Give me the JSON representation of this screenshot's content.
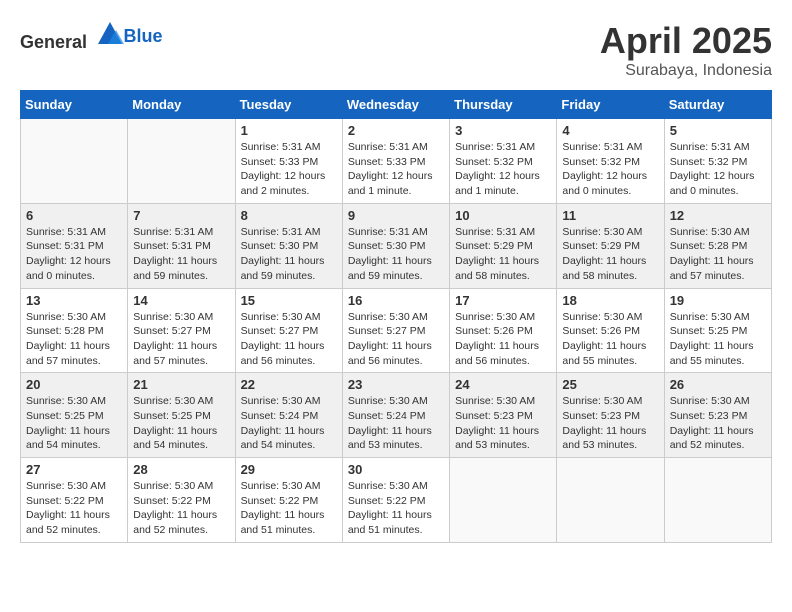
{
  "header": {
    "logo_general": "General",
    "logo_blue": "Blue",
    "month": "April 2025",
    "location": "Surabaya, Indonesia"
  },
  "days_of_week": [
    "Sunday",
    "Monday",
    "Tuesday",
    "Wednesday",
    "Thursday",
    "Friday",
    "Saturday"
  ],
  "weeks": [
    [
      {
        "day": "",
        "info": ""
      },
      {
        "day": "",
        "info": ""
      },
      {
        "day": "1",
        "info": "Sunrise: 5:31 AM\nSunset: 5:33 PM\nDaylight: 12 hours and 2 minutes."
      },
      {
        "day": "2",
        "info": "Sunrise: 5:31 AM\nSunset: 5:33 PM\nDaylight: 12 hours and 1 minute."
      },
      {
        "day": "3",
        "info": "Sunrise: 5:31 AM\nSunset: 5:32 PM\nDaylight: 12 hours and 1 minute."
      },
      {
        "day": "4",
        "info": "Sunrise: 5:31 AM\nSunset: 5:32 PM\nDaylight: 12 hours and 0 minutes."
      },
      {
        "day": "5",
        "info": "Sunrise: 5:31 AM\nSunset: 5:32 PM\nDaylight: 12 hours and 0 minutes."
      }
    ],
    [
      {
        "day": "6",
        "info": "Sunrise: 5:31 AM\nSunset: 5:31 PM\nDaylight: 12 hours and 0 minutes."
      },
      {
        "day": "7",
        "info": "Sunrise: 5:31 AM\nSunset: 5:31 PM\nDaylight: 11 hours and 59 minutes."
      },
      {
        "day": "8",
        "info": "Sunrise: 5:31 AM\nSunset: 5:30 PM\nDaylight: 11 hours and 59 minutes."
      },
      {
        "day": "9",
        "info": "Sunrise: 5:31 AM\nSunset: 5:30 PM\nDaylight: 11 hours and 59 minutes."
      },
      {
        "day": "10",
        "info": "Sunrise: 5:31 AM\nSunset: 5:29 PM\nDaylight: 11 hours and 58 minutes."
      },
      {
        "day": "11",
        "info": "Sunrise: 5:30 AM\nSunset: 5:29 PM\nDaylight: 11 hours and 58 minutes."
      },
      {
        "day": "12",
        "info": "Sunrise: 5:30 AM\nSunset: 5:28 PM\nDaylight: 11 hours and 57 minutes."
      }
    ],
    [
      {
        "day": "13",
        "info": "Sunrise: 5:30 AM\nSunset: 5:28 PM\nDaylight: 11 hours and 57 minutes."
      },
      {
        "day": "14",
        "info": "Sunrise: 5:30 AM\nSunset: 5:27 PM\nDaylight: 11 hours and 57 minutes."
      },
      {
        "day": "15",
        "info": "Sunrise: 5:30 AM\nSunset: 5:27 PM\nDaylight: 11 hours and 56 minutes."
      },
      {
        "day": "16",
        "info": "Sunrise: 5:30 AM\nSunset: 5:27 PM\nDaylight: 11 hours and 56 minutes."
      },
      {
        "day": "17",
        "info": "Sunrise: 5:30 AM\nSunset: 5:26 PM\nDaylight: 11 hours and 56 minutes."
      },
      {
        "day": "18",
        "info": "Sunrise: 5:30 AM\nSunset: 5:26 PM\nDaylight: 11 hours and 55 minutes."
      },
      {
        "day": "19",
        "info": "Sunrise: 5:30 AM\nSunset: 5:25 PM\nDaylight: 11 hours and 55 minutes."
      }
    ],
    [
      {
        "day": "20",
        "info": "Sunrise: 5:30 AM\nSunset: 5:25 PM\nDaylight: 11 hours and 54 minutes."
      },
      {
        "day": "21",
        "info": "Sunrise: 5:30 AM\nSunset: 5:25 PM\nDaylight: 11 hours and 54 minutes."
      },
      {
        "day": "22",
        "info": "Sunrise: 5:30 AM\nSunset: 5:24 PM\nDaylight: 11 hours and 54 minutes."
      },
      {
        "day": "23",
        "info": "Sunrise: 5:30 AM\nSunset: 5:24 PM\nDaylight: 11 hours and 53 minutes."
      },
      {
        "day": "24",
        "info": "Sunrise: 5:30 AM\nSunset: 5:23 PM\nDaylight: 11 hours and 53 minutes."
      },
      {
        "day": "25",
        "info": "Sunrise: 5:30 AM\nSunset: 5:23 PM\nDaylight: 11 hours and 53 minutes."
      },
      {
        "day": "26",
        "info": "Sunrise: 5:30 AM\nSunset: 5:23 PM\nDaylight: 11 hours and 52 minutes."
      }
    ],
    [
      {
        "day": "27",
        "info": "Sunrise: 5:30 AM\nSunset: 5:22 PM\nDaylight: 11 hours and 52 minutes."
      },
      {
        "day": "28",
        "info": "Sunrise: 5:30 AM\nSunset: 5:22 PM\nDaylight: 11 hours and 52 minutes."
      },
      {
        "day": "29",
        "info": "Sunrise: 5:30 AM\nSunset: 5:22 PM\nDaylight: 11 hours and 51 minutes."
      },
      {
        "day": "30",
        "info": "Sunrise: 5:30 AM\nSunset: 5:22 PM\nDaylight: 11 hours and 51 minutes."
      },
      {
        "day": "",
        "info": ""
      },
      {
        "day": "",
        "info": ""
      },
      {
        "day": "",
        "info": ""
      }
    ]
  ]
}
